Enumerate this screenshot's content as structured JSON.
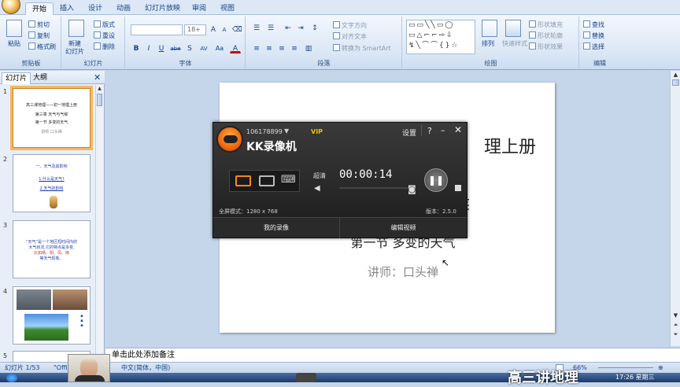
{
  "tabs": [
    "开始",
    "插入",
    "设计",
    "动画",
    "幻灯片放映",
    "审阅",
    "视图"
  ],
  "ribbon": {
    "clipboard": {
      "paste": "粘贴",
      "cut": "剪切",
      "copy": "复制",
      "format_painter": "格式刷",
      "label": "剪贴板"
    },
    "slides": {
      "new_slide": "新建\n幻灯片",
      "layout": "版式",
      "reset": "重设",
      "delete": "删除",
      "label": "幻灯片"
    },
    "font": {
      "font_size": "18+",
      "label": "字体",
      "bold": "B",
      "italic": "I",
      "underline": "U",
      "strike": "abe",
      "shadow": "S",
      "spacing": "AV",
      "case": "Aa",
      "color": "A"
    },
    "paragraph": {
      "text_direction": "文字方向",
      "align_text": "对齐文本",
      "smartart": "转换为 SmartArt",
      "label": "段落"
    },
    "drawing": {
      "arrange": "排列",
      "quick_styles": "快速样式",
      "shape_fill": "形状填充",
      "shape_outline": "形状轮廓",
      "shape_effects": "形状效果",
      "label": "绘图"
    },
    "editing": {
      "find": "查找",
      "replace": "替换",
      "select": "选择",
      "label": "编辑"
    }
  },
  "left_pane": {
    "tab_slides": "幻灯片",
    "tab_outline": "大纲",
    "thumbs": [
      {
        "num": "1",
        "lines": [
          "高三课地理——初一地理上册",
          "第三章 天气与气候",
          "第一节 多变的天气",
          "讲师 口头禅"
        ]
      },
      {
        "num": "2",
        "lines": [
          "一、天气及其影响",
          "1.什么是天气?",
          "2.天气的影响"
        ]
      },
      {
        "num": "3",
        "lines": [
          "“天气”是一个地区短时间内的",
          "大气状况,它的特点是多变,",
          "比如晴、阴、风、雨",
          "等天气现象。"
        ]
      },
      {
        "num": "4",
        "lines": []
      },
      {
        "num": "5",
        "lines": []
      }
    ]
  },
  "slide": {
    "title_fragment": "理上册",
    "subtitle_fragment": "侯",
    "section": "第一节 多变的天气",
    "presenter": "讲师：口头禅"
  },
  "notes_placeholder": "单击此处添加备注",
  "status": {
    "slide_info": "幻灯片 1/53",
    "theme": "\"Office",
    "language": "中文(简体，中国)",
    "zoom": "66%"
  },
  "kk": {
    "user_id": "106178899",
    "vip": "VIP",
    "settings": "设置",
    "help": "?",
    "title": "KK录像机",
    "quality": "超清",
    "timer": "00:00:14",
    "mode": "全屏模式：1280 x 768",
    "version": "版本：2.5.0",
    "my_recordings": "我的录像",
    "edit_video": "编辑视频"
  },
  "overlay_text": "高三讲地理",
  "taskbar_time": "17:26 星期三",
  "colors": {
    "ribbon": "#dbe7f5",
    "selected_thumb": "#f2b866",
    "kk_bg": "#2a2a2a",
    "kk_vip": "#e6c200"
  }
}
